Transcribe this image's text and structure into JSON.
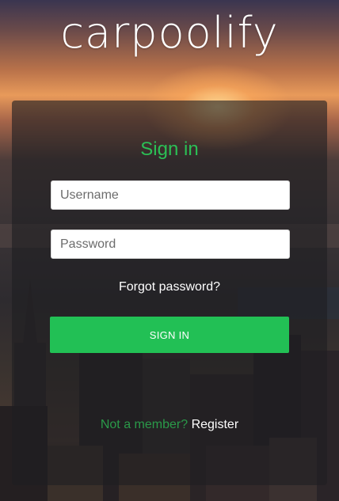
{
  "app": {
    "logo_text": "carpoolify"
  },
  "signin_card": {
    "title": "Sign in",
    "username_placeholder": "Username",
    "password_placeholder": "Password",
    "forgot_password": "Forgot password?",
    "submit_label": "SIGN IN",
    "not_member_text": "Not a member?",
    "register_label": "Register"
  },
  "colors": {
    "accent": "#22c055",
    "title": "#2bbf55",
    "not_member": "#2a9a49",
    "card_background": "rgba(30,30,34,0.62)"
  }
}
